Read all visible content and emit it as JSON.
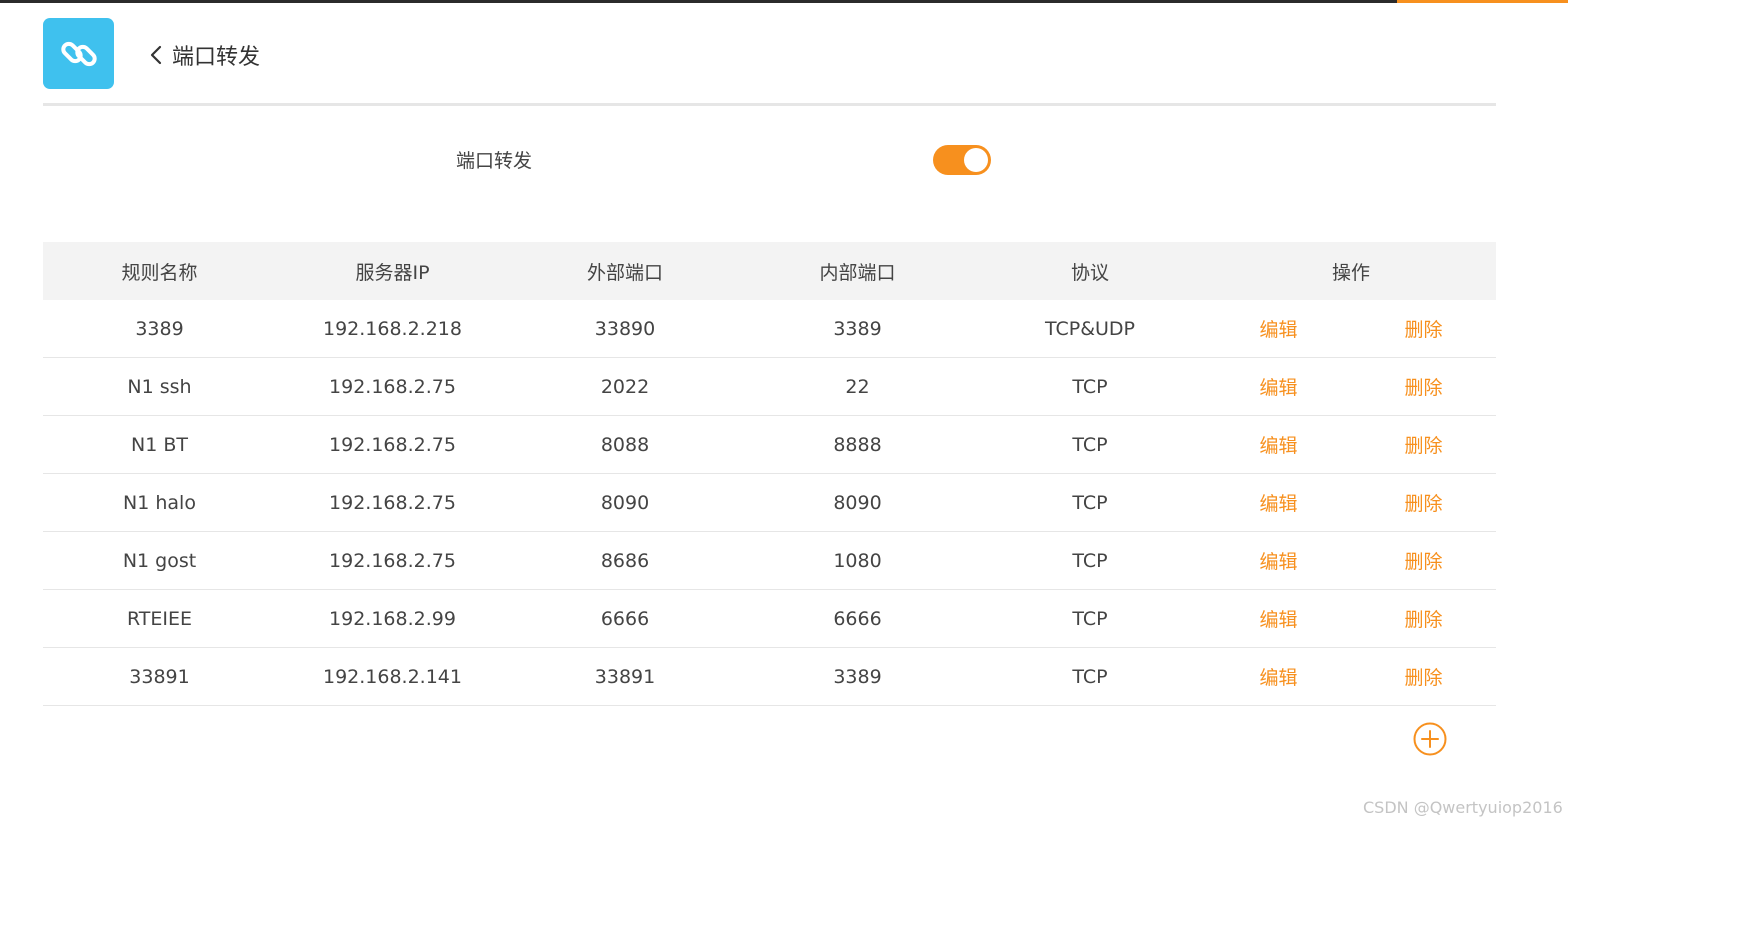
{
  "colors": {
    "accent": "#f7901e",
    "app_icon_bg": "#3fc1ee",
    "header_bg": "#f3f3f3",
    "top_bar": "#2b2b2b"
  },
  "icons": {
    "app": "link-icon",
    "back": "chevron-left-icon",
    "add": "plus-circle-icon"
  },
  "header": {
    "title": "端口转发"
  },
  "settings": {
    "port_forwarding_label": "端口转发",
    "port_forwarding_enabled": true
  },
  "table": {
    "columns": [
      "规则名称",
      "服务器IP",
      "外部端口",
      "内部端口",
      "协议",
      "操作"
    ],
    "edit_label": "编辑",
    "delete_label": "删除",
    "rows": [
      {
        "name": "3389",
        "server_ip": "192.168.2.218",
        "external_port": "33890",
        "internal_port": "3389",
        "protocol": "TCP&UDP"
      },
      {
        "name": "N1 ssh",
        "server_ip": "192.168.2.75",
        "external_port": "2022",
        "internal_port": "22",
        "protocol": "TCP"
      },
      {
        "name": "N1 BT",
        "server_ip": "192.168.2.75",
        "external_port": "8088",
        "internal_port": "8888",
        "protocol": "TCP"
      },
      {
        "name": "N1 halo",
        "server_ip": "192.168.2.75",
        "external_port": "8090",
        "internal_port": "8090",
        "protocol": "TCP"
      },
      {
        "name": "N1 gost",
        "server_ip": "192.168.2.75",
        "external_port": "8686",
        "internal_port": "1080",
        "protocol": "TCP"
      },
      {
        "name": "RTEIEE",
        "server_ip": "192.168.2.99",
        "external_port": "6666",
        "internal_port": "6666",
        "protocol": "TCP"
      },
      {
        "name": "33891",
        "server_ip": "192.168.2.141",
        "external_port": "33891",
        "internal_port": "3389",
        "protocol": "TCP"
      }
    ]
  },
  "watermark": "CSDN @Qwertyuiop2016"
}
